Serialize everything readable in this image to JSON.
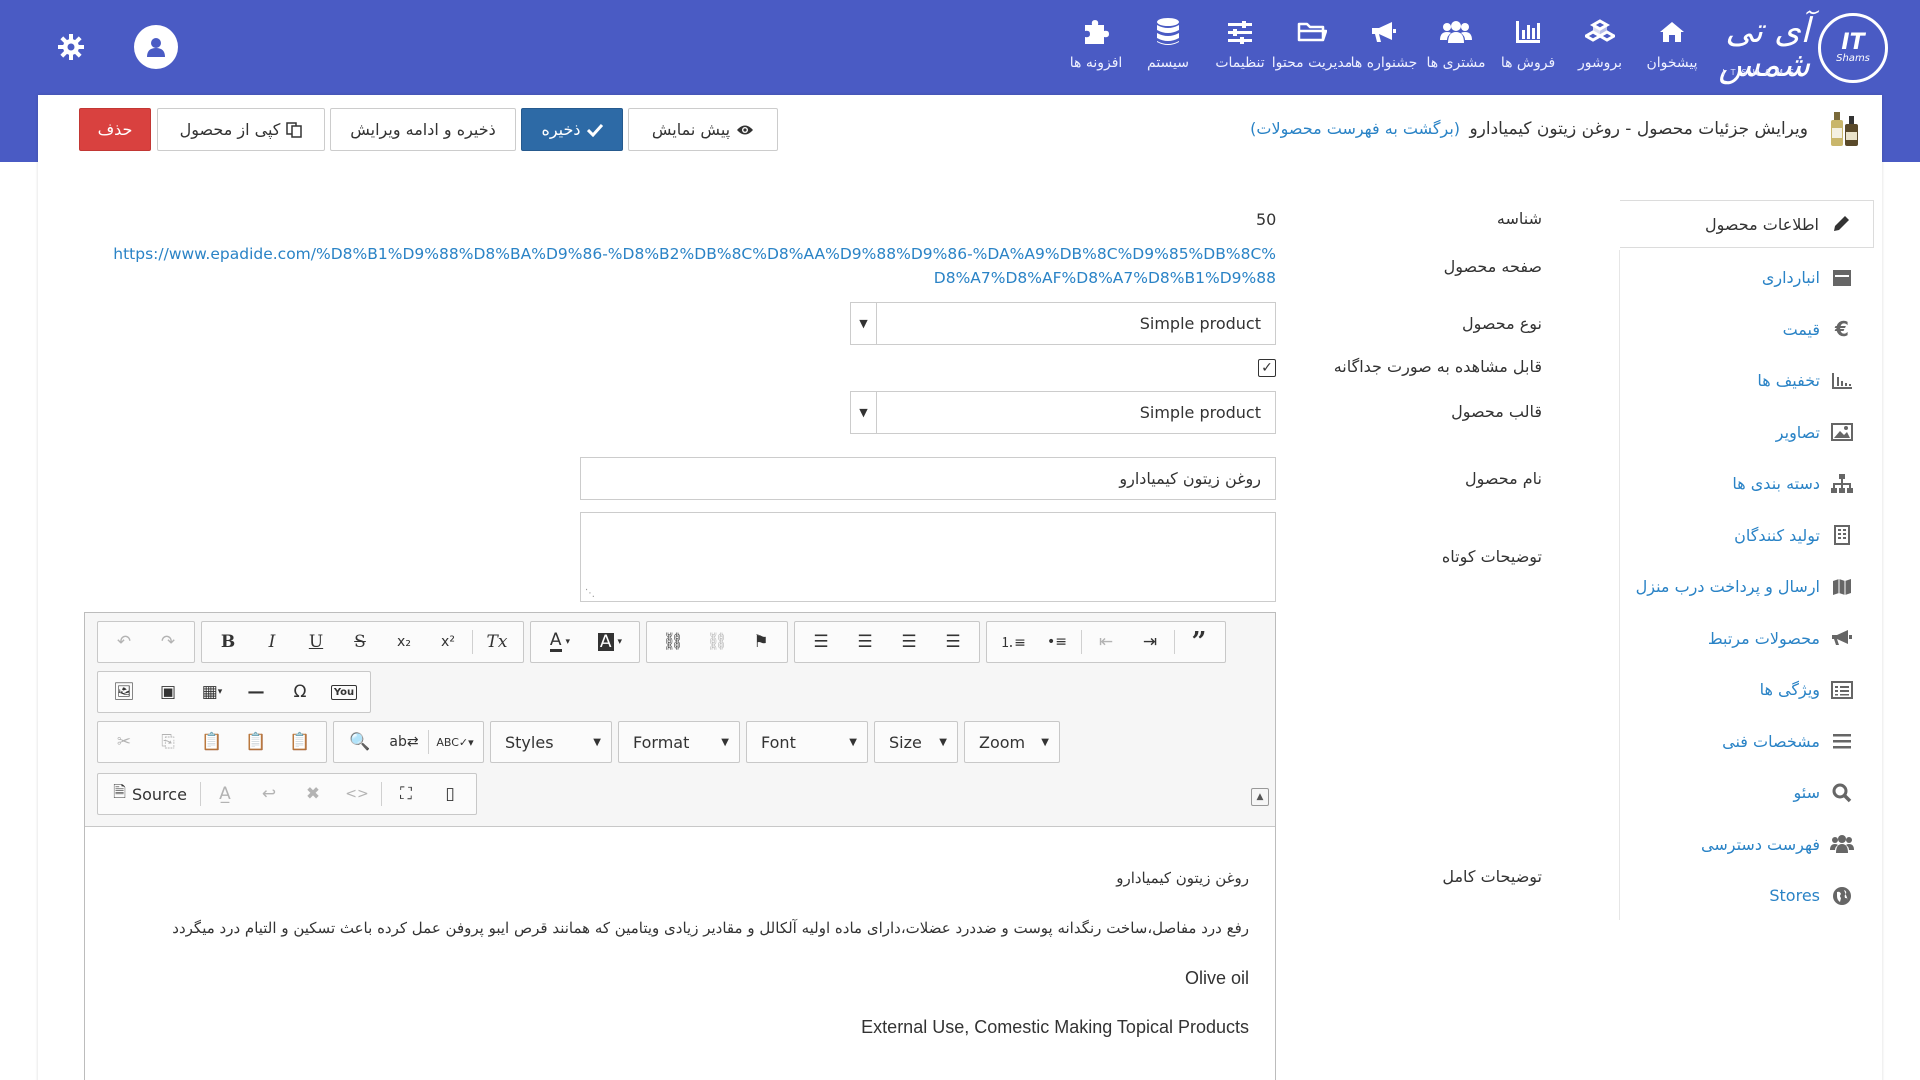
{
  "brand": {
    "logo_text": "IT",
    "logo_sub": "Shams",
    "name": "آی تی شمس",
    "subtitle": "ITSHAMS"
  },
  "nav": [
    {
      "label": "پیشخوان",
      "icon": "home-icon"
    },
    {
      "label": "بروشور",
      "icon": "cubes-icon"
    },
    {
      "label": "فروش ها",
      "icon": "bar-chart-icon"
    },
    {
      "label": "مشتری ها",
      "icon": "users-icon"
    },
    {
      "label": "جشنواره ها",
      "icon": "bullhorn-icon"
    },
    {
      "label": "مدیریت محتوا",
      "icon": "folder-icon"
    },
    {
      "label": "تنظیمات",
      "icon": "sliders-icon"
    },
    {
      "label": "سیستم",
      "icon": "database-icon"
    },
    {
      "label": "افزونه ها",
      "icon": "puzzle-icon"
    }
  ],
  "header": {
    "title": "ویرایش جزئیات محصول - روغن زیتون کیمیادارو",
    "back_link": "(برگشت به فهرست محصولات)"
  },
  "actions": {
    "preview": "پیش نمایش",
    "save": "ذخیره",
    "save_continue": "ذخیره و ادامه ویرایش",
    "copy": "کپی از محصول",
    "delete": "حذف"
  },
  "sidebar": [
    {
      "label": "اطلاعات محصول",
      "icon": "pencil-icon"
    },
    {
      "label": "انبارداری",
      "icon": "inventory-icon"
    },
    {
      "label": "قیمت",
      "icon": "euro-icon"
    },
    {
      "label": "تخفیف ها",
      "icon": "discount-chart-icon"
    },
    {
      "label": "تصاویر",
      "icon": "image-icon"
    },
    {
      "label": "دسته بندی ها",
      "icon": "sitemap-icon"
    },
    {
      "label": "تولید کنندگان",
      "icon": "building-icon"
    },
    {
      "label": "ارسال و پرداخت درب منزل",
      "icon": "map-icon"
    },
    {
      "label": "محصولات مرتبط",
      "icon": "bullhorn-icon"
    },
    {
      "label": "ویژگی ها",
      "icon": "list-alt-icon"
    },
    {
      "label": "مشخصات فنی",
      "icon": "bars-icon"
    },
    {
      "label": "سئو",
      "icon": "search-icon"
    },
    {
      "label": "فهرست دسترسی",
      "icon": "users-icon"
    },
    {
      "label": "Stores",
      "icon": "globe-icon"
    }
  ],
  "form": {
    "id_label": "شناسه",
    "id_value": "50",
    "page_label": "صفحه محصول",
    "page_url": "https://www.epadide.com/%D8%B1%D9%88%D8%BA%D9%86-%D8%B2%DB%8C%D8%AA%D9%88%D9%86-%DA%A9%DB%8C%D9%85%DB%8C%D8%A7%D8%AF%D8%A7%D8%B1%D9%88",
    "type_label": "نوع محصول",
    "type_value": "Simple product",
    "visible_label": "قابل مشاهده به صورت جداگانه",
    "visible_checked": true,
    "template_label": "قالب محصول",
    "template_value": "Simple product",
    "name_label": "نام محصول",
    "name_value": "روغن زیتون کیمیادارو",
    "short_desc_label": "توضیحات کوتاه",
    "short_desc_value": "",
    "full_desc_label": "توضیحات کامل"
  },
  "editor": {
    "combos": {
      "styles": "Styles",
      "format": "Format",
      "font": "Font",
      "size": "Size",
      "zoom": "Zoom"
    },
    "source_label": "Source",
    "content": [
      "روغن زیتون کیمیادارو",
      "رفع درد مفاصل،ساخت رنگدانه پوست و ضددرد عضلات،دارای ماده اولیه آلکالل و مقادیر زیادی ویتامین که همانند قرص ایبو پروفن عمل کرده باعث تسکین و التیام درد میگردد",
      "Olive oil",
      "External Use, Comestic Making Topical Products"
    ]
  },
  "colors": {
    "header_bg": "#4a5bc4",
    "primary_btn": "#2d6aa6",
    "danger_btn": "#d9413f",
    "link": "#2a83c6"
  }
}
